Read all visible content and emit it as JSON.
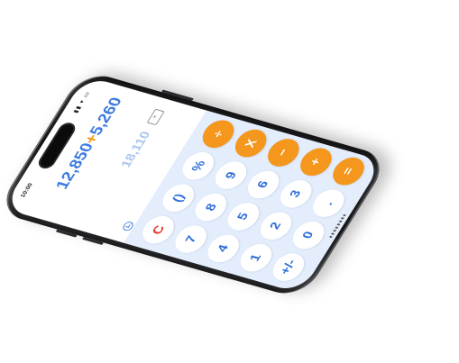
{
  "status": {
    "time": "10:00",
    "icons": "▮▮ ▾ ▭"
  },
  "display": {
    "expression_left": "12,850",
    "expression_op": "+",
    "expression_right": "5,260",
    "result": "18,110"
  },
  "keypad": {
    "keys": [
      "C",
      "()",
      "%",
      "÷",
      "7",
      "8",
      "9",
      "X",
      "4",
      "5",
      "6",
      "−",
      "1",
      "2",
      "3",
      "+",
      "+/-",
      "0",
      ".",
      "="
    ]
  },
  "colors": {
    "accent_blue": "#3d7be0",
    "operator_orange": "#f5961d",
    "clear_red": "#e23b2f",
    "keypad_bg": "#e3edfb"
  },
  "icons": {
    "history": "history-clock-icon",
    "backspace": "backspace-icon"
  }
}
